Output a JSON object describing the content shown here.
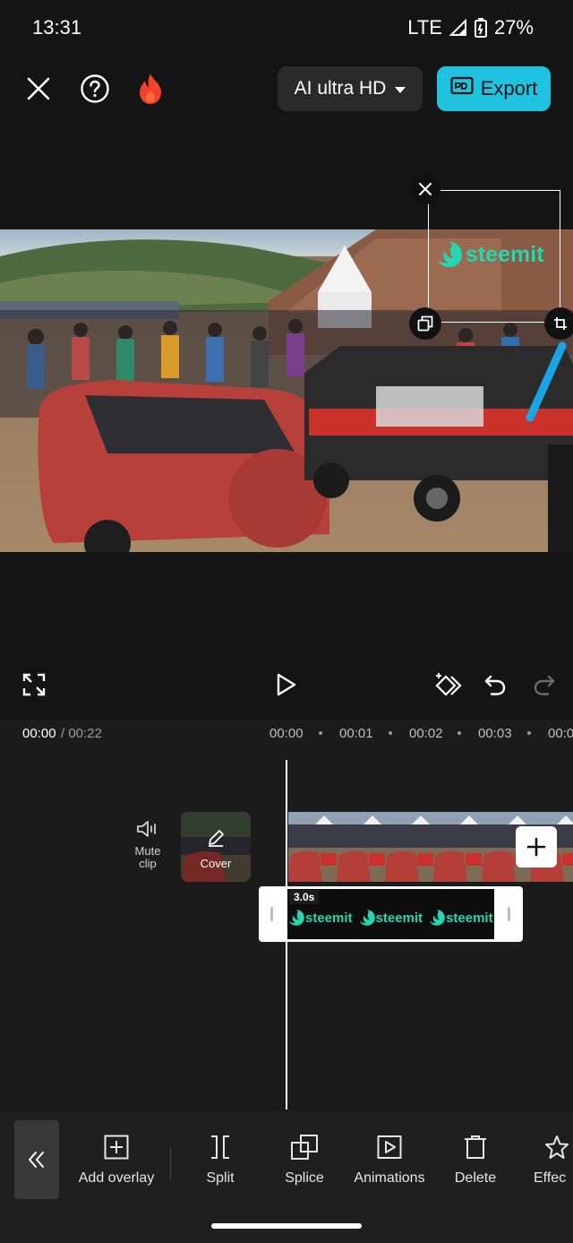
{
  "status": {
    "time": "13:31",
    "network": "LTE",
    "battery": "27%"
  },
  "header": {
    "quality_label": "AI ultra HD",
    "export_label": "Export",
    "icons": [
      "close-icon",
      "help-icon",
      "fire-icon",
      "chevron-down-icon",
      "export-icon"
    ]
  },
  "preview": {
    "watermark_text": "steemit"
  },
  "controls": {
    "icons": [
      "fullscreen-icon",
      "play-icon",
      "keyframe-icon",
      "undo-icon",
      "redo-icon"
    ]
  },
  "timeline": {
    "current_time": "00:00",
    "total_time": "/ 00:22",
    "ruler": [
      "00:00",
      "00:01",
      "00:02",
      "00:03",
      "00:0"
    ],
    "mute_label_1": "Mute",
    "mute_label_2": "clip",
    "cover_label": "Cover",
    "overlay_duration": "3.0s",
    "overlay_marks": [
      "steemit",
      "steemit",
      "steemit"
    ]
  },
  "toolbar": {
    "items": [
      {
        "label": "Add overlay",
        "icon": "add-overlay-icon"
      },
      {
        "label": "Split",
        "icon": "split-icon"
      },
      {
        "label": "Splice",
        "icon": "splice-icon"
      },
      {
        "label": "Animations",
        "icon": "animations-icon"
      },
      {
        "label": "Delete",
        "icon": "delete-icon"
      },
      {
        "label": "Effec",
        "icon": "effects-icon"
      }
    ]
  },
  "colors": {
    "accent": "#1fc3e0",
    "watermark": "#23d8b0",
    "background": "#141414"
  }
}
